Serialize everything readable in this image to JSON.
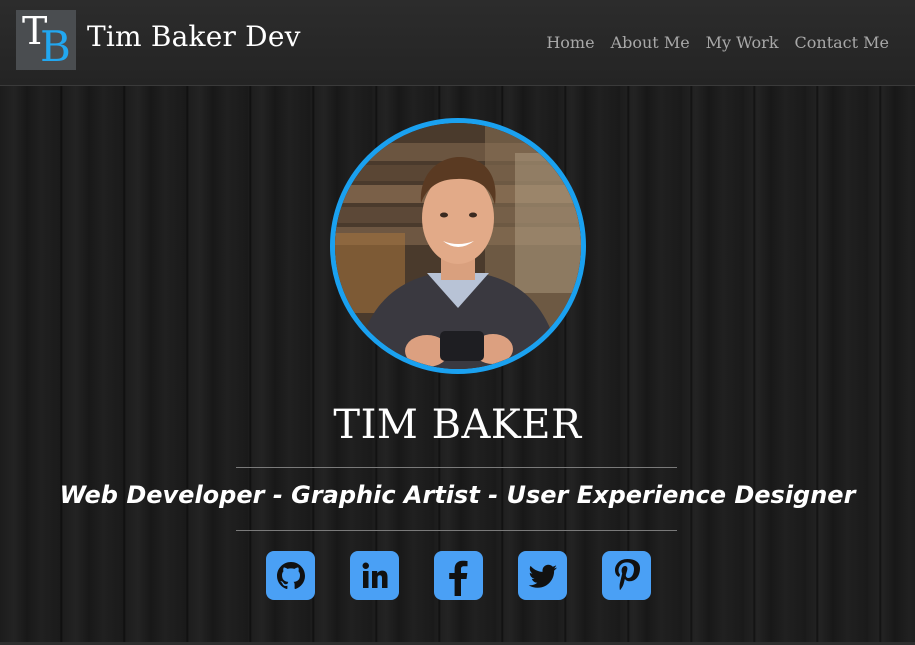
{
  "header": {
    "logo_letters": "TB",
    "site_title": "Tim Baker Dev",
    "nav": [
      {
        "label": "Home"
      },
      {
        "label": "About Me"
      },
      {
        "label": "My Work"
      },
      {
        "label": "Contact Me"
      }
    ]
  },
  "hero": {
    "name": "TIM BAKER",
    "tagline": "Web Developer - Graphic Artist - User Experience Designer",
    "avatar_alt": "profile-photo"
  },
  "socials": [
    {
      "icon": "github-icon"
    },
    {
      "icon": "linkedin-icon"
    },
    {
      "icon": "facebook-icon"
    },
    {
      "icon": "twitter-icon"
    },
    {
      "icon": "pinterest-icon"
    }
  ],
  "colors": {
    "accent": "#1aa1f0",
    "icon_bg": "#4aa0f5",
    "header_bg": "#282828",
    "text": "#ffffff",
    "nav_text": "#a8a8a8"
  }
}
